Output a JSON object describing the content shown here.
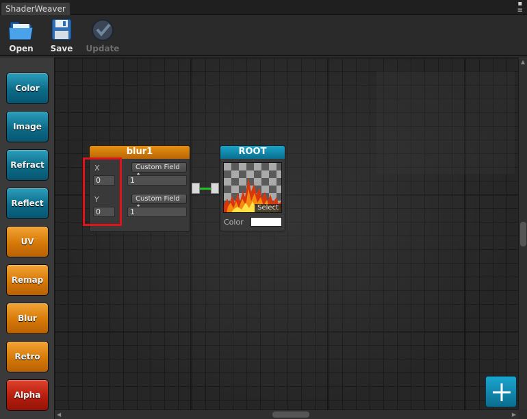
{
  "window": {
    "tab_title": "ShaderWeaver"
  },
  "toolbar": {
    "open_label": "Open",
    "save_label": "Save",
    "update_label": "Update"
  },
  "palette": {
    "items": [
      {
        "label": "Color",
        "color": "teal"
      },
      {
        "label": "Image",
        "color": "teal"
      },
      {
        "label": "Refract",
        "color": "teal"
      },
      {
        "label": "Reflect",
        "color": "teal"
      },
      {
        "label": "UV",
        "color": "orange"
      },
      {
        "label": "Remap",
        "color": "orange"
      },
      {
        "label": "Blur",
        "color": "orange"
      },
      {
        "label": "Retro",
        "color": "orange"
      },
      {
        "label": "Alpha",
        "color": "red"
      }
    ]
  },
  "blur_node": {
    "title": "blur1",
    "x_label": "X",
    "x_value": "0",
    "y_label": "Y",
    "y_value": "0",
    "dropdown1": "Custom Field ↕",
    "field1": "1",
    "dropdown2": "Custom Field ↕",
    "field2": "1"
  },
  "root_node": {
    "title": "ROOT",
    "select_label": "Select",
    "color_label": "Color",
    "color_value": "#ffffff"
  },
  "colors": {
    "teal": "#0c6b87",
    "orange": "#d67908",
    "red": "#b51d0e",
    "highlight": "#e0131a",
    "wire": "#22c327"
  }
}
